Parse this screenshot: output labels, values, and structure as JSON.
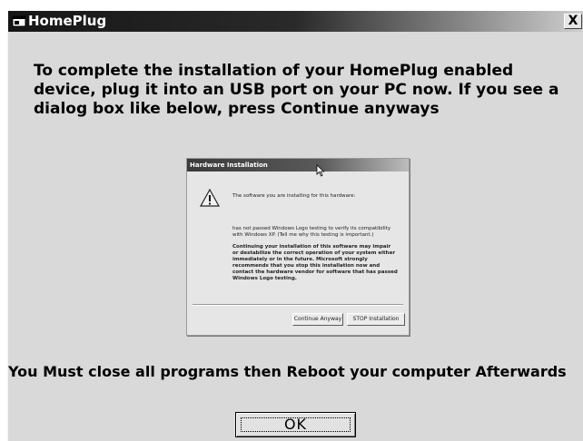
{
  "window": {
    "title": "HomePlug",
    "close_glyph": "X",
    "icon": "app-window-icon"
  },
  "main": {
    "instruction": "To complete the installation of your HomePlug enabled device, plug it into an USB port on your PC now.  If you see a dialog box like below, press Continue anyways",
    "reboot_note": "You Must close all programs then Reboot your computer Afterwards",
    "ok_label": "OK"
  },
  "preview": {
    "title": "Hardware Installation",
    "line1": "The software you are installing for this hardware:",
    "line2": "has not passed Windows Logo testing to verify its compatibility with Windows XP. (Tell me why this testing is important.)",
    "line3": "Continuing your installation of this software may impair or destabilize the correct operation of your system either immediately or in the future. Microsoft strongly recommends that you stop this installation now and contact the hardware vendor for software that has passed Windows Logo testing.",
    "continue_label": "Continue Anyway",
    "stop_label": "STOP Installation",
    "warning_icon": "warning-icon"
  },
  "colors": {
    "titlebar": "#161616",
    "body": "#d9d9d9"
  }
}
